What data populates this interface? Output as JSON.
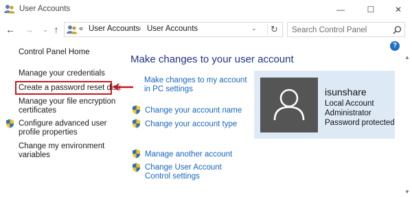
{
  "window": {
    "title": "User Accounts",
    "minimize_glyph": "—",
    "maximize_glyph": "☐",
    "close_glyph": "✕"
  },
  "nav": {
    "back_glyph": "←",
    "forward_glyph": "→",
    "history_glyph": "⌄",
    "up_glyph": "↑",
    "address_separator": "«",
    "breadcrumb": [
      "User Accounts",
      "User Accounts"
    ],
    "breadcrumb_arrow": "›",
    "address_drop_glyph": "⌄",
    "refresh_glyph": "↻",
    "search_placeholder": "Search Control Panel"
  },
  "left_pane": {
    "home": "Control Panel Home",
    "credentials": "Manage your credentials",
    "reset_disk": "Create a password reset disk",
    "encryption": "Manage your file encryption certificates",
    "advanced_profile": "Configure advanced user profile properties",
    "environment": "Change my environment variables"
  },
  "main": {
    "heading": "Make changes to your user account",
    "pc_settings": "Make changes to my account in PC settings",
    "change_name": "Change your account name",
    "change_type": "Change your account type",
    "manage_another": "Manage another account",
    "uac_settings": "Change User Account Control settings"
  },
  "account": {
    "name": "isunshare",
    "type": "Local Account",
    "role": "Administrator",
    "password_status": "Password protected"
  },
  "help_glyph": "?",
  "scrollbar": {
    "up_glyph": "▲",
    "down_glyph": "▼"
  },
  "colors": {
    "link": "#1565c0",
    "heading": "#1e3287",
    "highlight": "#c8161d",
    "card_bg": "#ddeaf6",
    "avatar_bg": "#555555"
  },
  "icons": {
    "app": "users-icon",
    "shield": "uac-shield-icon",
    "search": "search-icon",
    "avatar": "user-silhouette-icon",
    "annotation": "red-arrow-icon"
  }
}
